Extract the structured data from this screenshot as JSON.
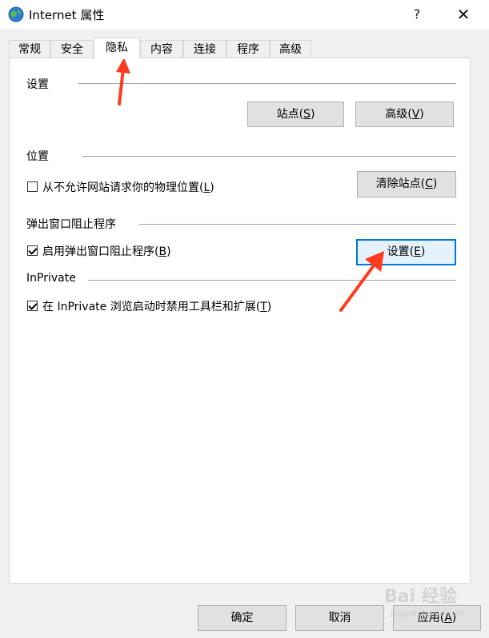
{
  "window": {
    "title": "Internet 属性",
    "help": "?",
    "close": "✕"
  },
  "tabs": [
    "常规",
    "安全",
    "隐私",
    "内容",
    "连接",
    "程序",
    "高级"
  ],
  "active_tab": "隐私",
  "settings_group": {
    "label": "设置",
    "sites_button": {
      "text": "站点(",
      "key": "S",
      "end": ")"
    },
    "advanced_button": {
      "text": "高级(",
      "key": "V",
      "end": ")"
    }
  },
  "location_group": {
    "label": "位置",
    "checkbox": {
      "text": "从不允许网站请求你的物理位置(",
      "key": "L",
      "end": ")",
      "checked": false
    },
    "clear_button": {
      "text": "清除站点(",
      "key": "C",
      "end": ")"
    }
  },
  "popup_group": {
    "label": "弹出窗口阻止程序",
    "checkbox": {
      "text": "启用弹出窗口阻止程序(",
      "key": "B",
      "end": ")",
      "checked": true
    },
    "settings_button": {
      "text": "设置(",
      "key": "E",
      "end": ")"
    }
  },
  "inprivate_group": {
    "label": "InPrivate",
    "checkbox": {
      "text": "在 InPrivate 浏览启动时禁用工具栏和扩展(",
      "key": "T",
      "end": ")",
      "checked": true
    }
  },
  "footer": {
    "ok": "确定",
    "cancel": "取消",
    "apply": {
      "text": "应用(",
      "key": "A",
      "end": ")"
    }
  },
  "watermark": {
    "text": "Bai 经验",
    "sub": "jingyan.baidu.com"
  },
  "colors": {
    "accent": "#0078d7",
    "annotation_arrow": "#ff3b1f"
  }
}
